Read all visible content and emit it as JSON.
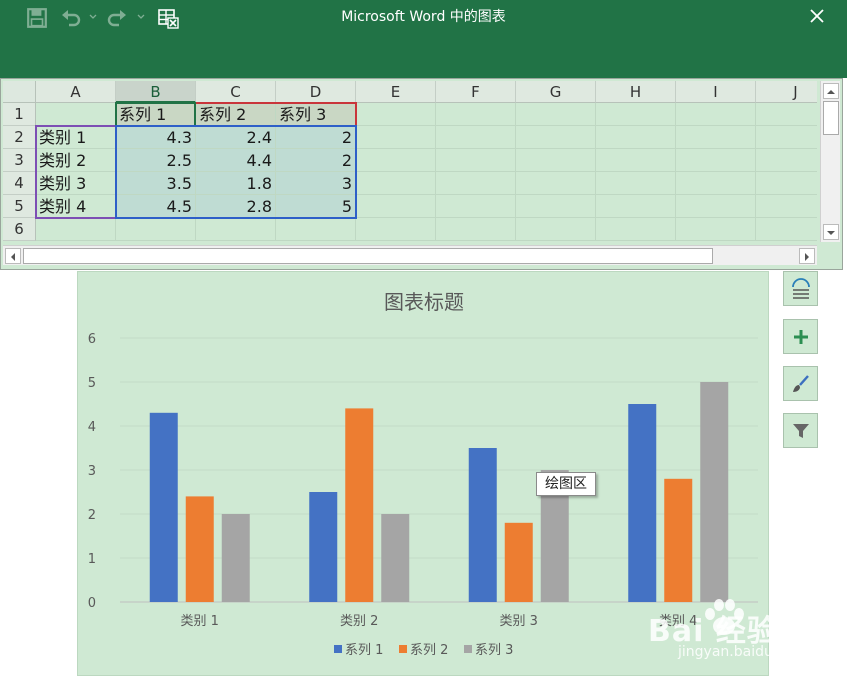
{
  "window": {
    "title": "Microsoft Word 中的图表",
    "icons": [
      "save-icon",
      "undo-icon",
      "redo-icon",
      "edit-data-in-excel-icon",
      "close-icon"
    ],
    "colors": {
      "titlebar": "#217346",
      "sheet_bg": "#cfe9d3"
    }
  },
  "sheet": {
    "columns": [
      "A",
      "B",
      "C",
      "D",
      "E",
      "F",
      "G",
      "H",
      "I",
      "J"
    ],
    "selected_column": "B",
    "rows": [
      "1",
      "2",
      "3",
      "4",
      "5",
      "6"
    ],
    "header_row": [
      "",
      "系列 1",
      "系列 2",
      "系列 3"
    ],
    "data_rows": [
      [
        "类别 1",
        "4.3",
        "2.4",
        "2"
      ],
      [
        "类别 2",
        "2.5",
        "4.4",
        "2"
      ],
      [
        "类别 3",
        "3.5",
        "1.8",
        "3"
      ],
      [
        "类别 4",
        "4.5",
        "2.8",
        "5"
      ]
    ],
    "range_colors": {
      "series": "#217346",
      "categories": "#7d4fb4",
      "values": "#2e5fc8",
      "series3": "#c9353b"
    }
  },
  "chart_data": {
    "type": "bar",
    "title": "图表标题",
    "categories": [
      "类别 1",
      "类别 2",
      "类别 3",
      "类别 4"
    ],
    "series": [
      {
        "name": "系列 1",
        "values": [
          4.3,
          2.5,
          3.5,
          4.5
        ],
        "color": "#4472c4"
      },
      {
        "name": "系列 2",
        "values": [
          2.4,
          4.4,
          1.8,
          2.8
        ],
        "color": "#ed7d31"
      },
      {
        "name": "系列 3",
        "values": [
          2,
          2,
          3,
          5
        ],
        "color": "#a5a5a5"
      }
    ],
    "ylim": [
      0,
      6
    ],
    "yticks": [
      "0",
      "1",
      "2",
      "3",
      "4",
      "5",
      "6"
    ],
    "grid": true,
    "legend": "bottom"
  },
  "chart_tools": {
    "buttons": [
      "chart-layout-icon",
      "chart-elements-icon",
      "chart-styles-icon",
      "chart-filters-icon"
    ]
  },
  "tooltip": {
    "text": "绘图区"
  },
  "watermark": {
    "brand": "Bai 经验",
    "url": "jingyan.baidu.com"
  }
}
